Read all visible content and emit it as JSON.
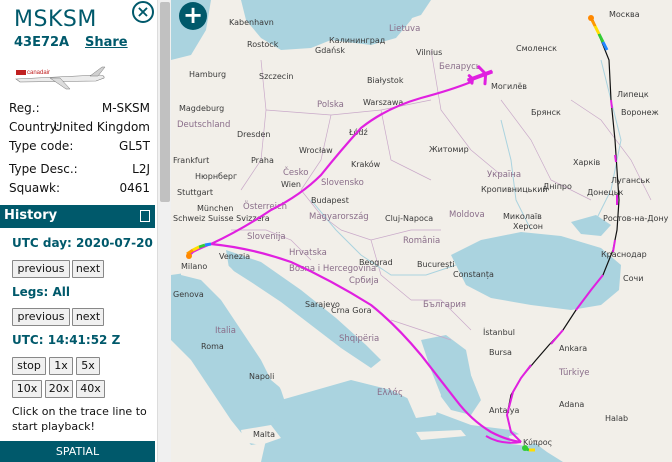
{
  "aircraft": {
    "callsign": "MSKSM",
    "hex": "43E72A",
    "share_label": "Share",
    "close_icon": "close-icon",
    "photo_caption": "canadair",
    "fields": [
      {
        "key": "Reg.:",
        "value": "M-SKSM"
      },
      {
        "key": "Country:",
        "value": "United Kingdom"
      },
      {
        "key": "Type code:",
        "value": "GL5T"
      },
      {
        "key": "Type Desc.:",
        "value": "L2J"
      },
      {
        "key": "Squawk:",
        "value": "0461"
      }
    ]
  },
  "history": {
    "title": "History",
    "utc_day": "UTC day: 2020-07-20",
    "previous": "previous",
    "next": "next",
    "legs": "Legs: All",
    "utc_time": "UTC: 14:41:52 Z",
    "stop": "stop",
    "speed_1x": "1x",
    "speed_5x": "5x",
    "speed_10x": "10x",
    "speed_20x": "20x",
    "speed_40x": "40x",
    "hint": "Click on the trace line to start playback!",
    "spatial": "SPATIAL"
  },
  "map": {
    "zoom_in": "+",
    "trace_color": "#e020e0",
    "labels": [
      {
        "text": "Kabenhavn"
      },
      {
        "text": "Калининград"
      },
      {
        "text": "Lietuva"
      },
      {
        "text": "Vilnius"
      },
      {
        "text": "Rostock"
      },
      {
        "text": "Gdańsk"
      },
      {
        "text": "Hamburg"
      },
      {
        "text": "Szczecin"
      },
      {
        "text": "Białystok"
      },
      {
        "text": "Смоленск"
      },
      {
        "text": "Москва"
      },
      {
        "text": "Беларусь"
      },
      {
        "text": "Могилёв"
      },
      {
        "text": "Magdeburg"
      },
      {
        "text": "Polska"
      },
      {
        "text": "Warszawa"
      },
      {
        "text": "Брянск"
      },
      {
        "text": "Липецк"
      },
      {
        "text": "Deutschland"
      },
      {
        "text": "Dresden"
      },
      {
        "text": "Łódź"
      },
      {
        "text": "Воронеж"
      },
      {
        "text": "Wrocław"
      },
      {
        "text": "Praha"
      },
      {
        "text": "Frankfurt"
      },
      {
        "text": "Kraków"
      },
      {
        "text": "Житомир"
      },
      {
        "text": "Нюрнберг"
      },
      {
        "text": "Česko"
      },
      {
        "text": "Харків"
      },
      {
        "text": "Stuttgart"
      },
      {
        "text": "Wien"
      },
      {
        "text": "Slovensko"
      },
      {
        "text": "Україна"
      },
      {
        "text": "München"
      },
      {
        "text": "Österreich"
      },
      {
        "text": "Budapest"
      },
      {
        "text": "Дніпро"
      },
      {
        "text": "Донецьк"
      },
      {
        "text": "Schweiz Suisse Svizzera"
      },
      {
        "text": "Magyarország"
      },
      {
        "text": "Кропивницький"
      },
      {
        "text": "Луганськ"
      },
      {
        "text": "Slovenija"
      },
      {
        "text": "Hrvatska"
      },
      {
        "text": "Cluj-Napoca"
      },
      {
        "text": "Moldova"
      },
      {
        "text": "Миколаїв"
      },
      {
        "text": "Ростов-на-Дону"
      },
      {
        "text": "Milano"
      },
      {
        "text": "Venezia"
      },
      {
        "text": "Beograd"
      },
      {
        "text": "România"
      },
      {
        "text": "Херсон"
      },
      {
        "text": "Краснодар"
      },
      {
        "text": "Genova"
      },
      {
        "text": "Bosna i Hercegovina"
      },
      {
        "text": "Србија"
      },
      {
        "text": "București"
      },
      {
        "text": "Constanța"
      },
      {
        "text": "Сочи"
      },
      {
        "text": "Sarajevo"
      },
      {
        "text": "Crna Gora"
      },
      {
        "text": "България"
      },
      {
        "text": "Italia"
      },
      {
        "text": "Shqipëria"
      },
      {
        "text": "İstanbul"
      },
      {
        "text": "Bursa"
      },
      {
        "text": "Ankara"
      },
      {
        "text": "Türkiye"
      },
      {
        "text": "Ελλάς"
      },
      {
        "text": "Roma"
      },
      {
        "text": "Napoli"
      },
      {
        "text": "Antalya"
      },
      {
        "text": "Adana"
      },
      {
        "text": "Malta"
      },
      {
        "text": "Κύπρος"
      },
      {
        "text": "Halab"
      }
    ]
  }
}
